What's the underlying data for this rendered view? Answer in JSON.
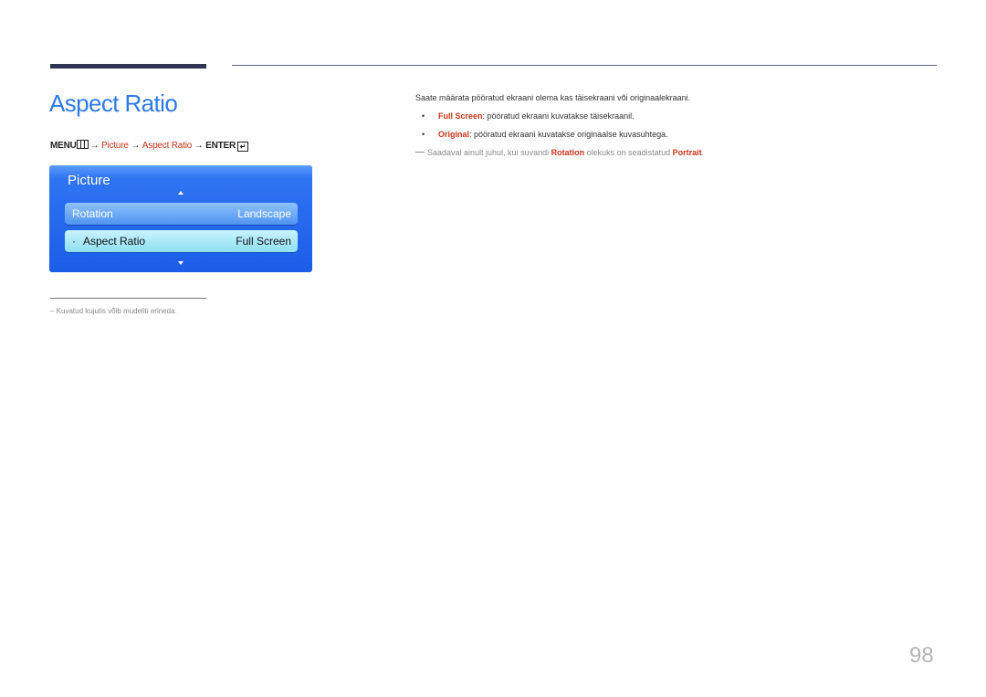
{
  "title": "Aspect Ratio",
  "menu_path": {
    "menu": "MENU",
    "arrow": "→",
    "step1": "Picture",
    "step2": "Aspect Ratio",
    "enter": "ENTER",
    "menu_icon": "menu-icon",
    "enter_icon": "enter-icon"
  },
  "osd": {
    "title": "Picture",
    "rows": [
      {
        "label": "Rotation",
        "value": "Landscape"
      },
      {
        "label": "Aspect Ratio",
        "value": "Full Screen",
        "selected": true
      }
    ]
  },
  "description": "Saate määrata pööratud ekraani olema kas täisekraani või originaalekraani.",
  "bullets": [
    {
      "term": "Full Screen",
      "text": ": pööratud ekraani kuvatakse täisekraanil."
    },
    {
      "term": "Original",
      "text": ": pööratud ekraani kuvatakse originaalse kuvasuhtega."
    }
  ],
  "note": {
    "pre": "Saadaval ainult juhul, kui suvandi ",
    "term1": "Rotation",
    "mid": " olekuks on seadistatud ",
    "term2": "Portrait",
    "post": "."
  },
  "footnote": "–  Kuvatud kujutis võib mudeliti erineda.",
  "page_number": "98",
  "colors": {
    "accent_blue": "#2e7ae8",
    "highlight_red": "#c8351b",
    "rule_dark": "#2f3452"
  }
}
